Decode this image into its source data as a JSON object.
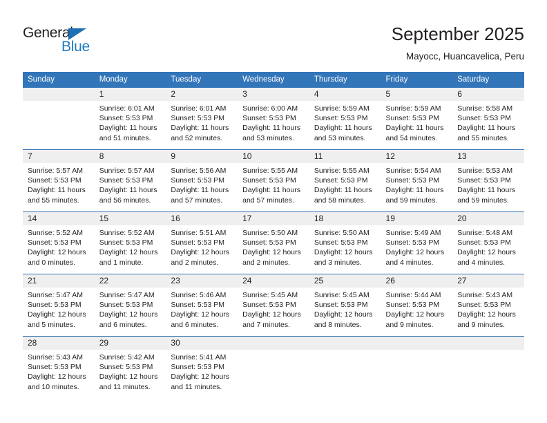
{
  "brand": {
    "name_top": "General",
    "name_bottom": "Blue",
    "accent_color": "#1f7ac0",
    "triangle_color": "#1f6fb5"
  },
  "header": {
    "title": "September 2025",
    "subtitle": "Mayocc, Huancavelica, Peru"
  },
  "calendar": {
    "header_bg": "#3275b9",
    "daynum_bg": "#efefef",
    "grid_line_color": "#2f6fae",
    "weekdays": [
      "Sunday",
      "Monday",
      "Tuesday",
      "Wednesday",
      "Thursday",
      "Friday",
      "Saturday"
    ],
    "weeks": [
      [
        {
          "day": "",
          "lines": []
        },
        {
          "day": "1",
          "lines": [
            "Sunrise: 6:01 AM",
            "Sunset: 5:53 PM",
            "Daylight: 11 hours",
            "and 51 minutes."
          ]
        },
        {
          "day": "2",
          "lines": [
            "Sunrise: 6:01 AM",
            "Sunset: 5:53 PM",
            "Daylight: 11 hours",
            "and 52 minutes."
          ]
        },
        {
          "day": "3",
          "lines": [
            "Sunrise: 6:00 AM",
            "Sunset: 5:53 PM",
            "Daylight: 11 hours",
            "and 53 minutes."
          ]
        },
        {
          "day": "4",
          "lines": [
            "Sunrise: 5:59 AM",
            "Sunset: 5:53 PM",
            "Daylight: 11 hours",
            "and 53 minutes."
          ]
        },
        {
          "day": "5",
          "lines": [
            "Sunrise: 5:59 AM",
            "Sunset: 5:53 PM",
            "Daylight: 11 hours",
            "and 54 minutes."
          ]
        },
        {
          "day": "6",
          "lines": [
            "Sunrise: 5:58 AM",
            "Sunset: 5:53 PM",
            "Daylight: 11 hours",
            "and 55 minutes."
          ]
        }
      ],
      [
        {
          "day": "7",
          "lines": [
            "Sunrise: 5:57 AM",
            "Sunset: 5:53 PM",
            "Daylight: 11 hours",
            "and 55 minutes."
          ]
        },
        {
          "day": "8",
          "lines": [
            "Sunrise: 5:57 AM",
            "Sunset: 5:53 PM",
            "Daylight: 11 hours",
            "and 56 minutes."
          ]
        },
        {
          "day": "9",
          "lines": [
            "Sunrise: 5:56 AM",
            "Sunset: 5:53 PM",
            "Daylight: 11 hours",
            "and 57 minutes."
          ]
        },
        {
          "day": "10",
          "lines": [
            "Sunrise: 5:55 AM",
            "Sunset: 5:53 PM",
            "Daylight: 11 hours",
            "and 57 minutes."
          ]
        },
        {
          "day": "11",
          "lines": [
            "Sunrise: 5:55 AM",
            "Sunset: 5:53 PM",
            "Daylight: 11 hours",
            "and 58 minutes."
          ]
        },
        {
          "day": "12",
          "lines": [
            "Sunrise: 5:54 AM",
            "Sunset: 5:53 PM",
            "Daylight: 11 hours",
            "and 59 minutes."
          ]
        },
        {
          "day": "13",
          "lines": [
            "Sunrise: 5:53 AM",
            "Sunset: 5:53 PM",
            "Daylight: 11 hours",
            "and 59 minutes."
          ]
        }
      ],
      [
        {
          "day": "14",
          "lines": [
            "Sunrise: 5:52 AM",
            "Sunset: 5:53 PM",
            "Daylight: 12 hours",
            "and 0 minutes."
          ]
        },
        {
          "day": "15",
          "lines": [
            "Sunrise: 5:52 AM",
            "Sunset: 5:53 PM",
            "Daylight: 12 hours",
            "and 1 minute."
          ]
        },
        {
          "day": "16",
          "lines": [
            "Sunrise: 5:51 AM",
            "Sunset: 5:53 PM",
            "Daylight: 12 hours",
            "and 2 minutes."
          ]
        },
        {
          "day": "17",
          "lines": [
            "Sunrise: 5:50 AM",
            "Sunset: 5:53 PM",
            "Daylight: 12 hours",
            "and 2 minutes."
          ]
        },
        {
          "day": "18",
          "lines": [
            "Sunrise: 5:50 AM",
            "Sunset: 5:53 PM",
            "Daylight: 12 hours",
            "and 3 minutes."
          ]
        },
        {
          "day": "19",
          "lines": [
            "Sunrise: 5:49 AM",
            "Sunset: 5:53 PM",
            "Daylight: 12 hours",
            "and 4 minutes."
          ]
        },
        {
          "day": "20",
          "lines": [
            "Sunrise: 5:48 AM",
            "Sunset: 5:53 PM",
            "Daylight: 12 hours",
            "and 4 minutes."
          ]
        }
      ],
      [
        {
          "day": "21",
          "lines": [
            "Sunrise: 5:47 AM",
            "Sunset: 5:53 PM",
            "Daylight: 12 hours",
            "and 5 minutes."
          ]
        },
        {
          "day": "22",
          "lines": [
            "Sunrise: 5:47 AM",
            "Sunset: 5:53 PM",
            "Daylight: 12 hours",
            "and 6 minutes."
          ]
        },
        {
          "day": "23",
          "lines": [
            "Sunrise: 5:46 AM",
            "Sunset: 5:53 PM",
            "Daylight: 12 hours",
            "and 6 minutes."
          ]
        },
        {
          "day": "24",
          "lines": [
            "Sunrise: 5:45 AM",
            "Sunset: 5:53 PM",
            "Daylight: 12 hours",
            "and 7 minutes."
          ]
        },
        {
          "day": "25",
          "lines": [
            "Sunrise: 5:45 AM",
            "Sunset: 5:53 PM",
            "Daylight: 12 hours",
            "and 8 minutes."
          ]
        },
        {
          "day": "26",
          "lines": [
            "Sunrise: 5:44 AM",
            "Sunset: 5:53 PM",
            "Daylight: 12 hours",
            "and 9 minutes."
          ]
        },
        {
          "day": "27",
          "lines": [
            "Sunrise: 5:43 AM",
            "Sunset: 5:53 PM",
            "Daylight: 12 hours",
            "and 9 minutes."
          ]
        }
      ],
      [
        {
          "day": "28",
          "lines": [
            "Sunrise: 5:43 AM",
            "Sunset: 5:53 PM",
            "Daylight: 12 hours",
            "and 10 minutes."
          ]
        },
        {
          "day": "29",
          "lines": [
            "Sunrise: 5:42 AM",
            "Sunset: 5:53 PM",
            "Daylight: 12 hours",
            "and 11 minutes."
          ]
        },
        {
          "day": "30",
          "lines": [
            "Sunrise: 5:41 AM",
            "Sunset: 5:53 PM",
            "Daylight: 12 hours",
            "and 11 minutes."
          ]
        },
        {
          "day": "",
          "lines": []
        },
        {
          "day": "",
          "lines": []
        },
        {
          "day": "",
          "lines": []
        },
        {
          "day": "",
          "lines": []
        }
      ]
    ]
  }
}
